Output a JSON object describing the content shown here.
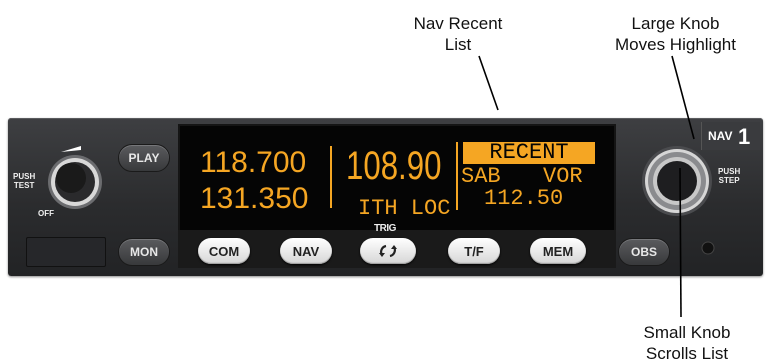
{
  "callouts": {
    "nav_recent": [
      "Nav Recent",
      "List"
    ],
    "large_knob": [
      "Large Knob",
      "Moves Highlight"
    ],
    "small_knob": [
      "Small Knob",
      "Scrolls List"
    ]
  },
  "display": {
    "com_active": "118.700",
    "com_standby": "131.350",
    "nav_active": "108.90",
    "nav_ident": "ITH LOC",
    "recent_header": "RECENT",
    "recent_items": [
      {
        "name": "SAB",
        "type": "VOR",
        "freq": "112.50"
      }
    ]
  },
  "controls": {
    "volume_push": "PUSH",
    "volume_test": "TEST",
    "volume_off": "OFF",
    "play": "PLAY",
    "mon": "MON",
    "com": "COM",
    "nav": "NAV",
    "trig_logo": "TRIG",
    "swap_icon": "swap-arrows-icon",
    "tf": "T/F",
    "mem": "MEM",
    "obs": "OBS",
    "nav_badge_text": "NAV",
    "nav_badge_num": "1",
    "knob_push": "PUSH",
    "knob_step": "STEP"
  },
  "colors": {
    "display_amber": "#f5a623",
    "panel": "#2e2f31"
  }
}
